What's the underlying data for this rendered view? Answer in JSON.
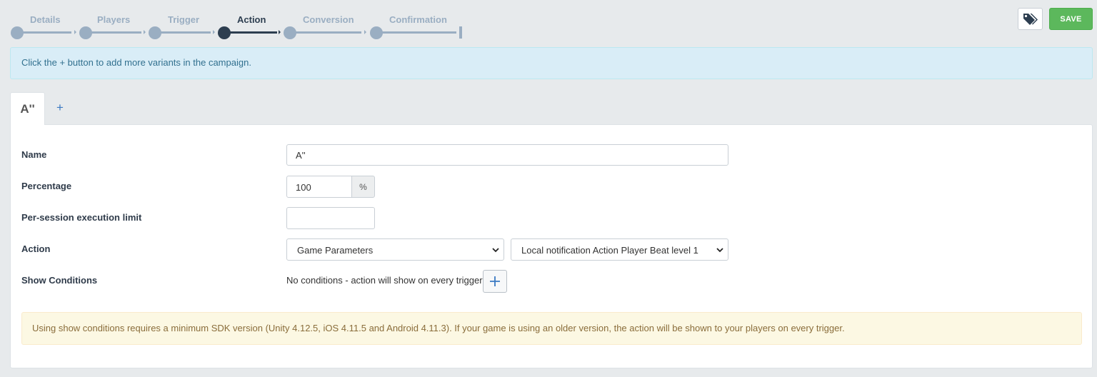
{
  "wizard": {
    "steps": [
      {
        "label": "Details",
        "state": "done"
      },
      {
        "label": "Players",
        "state": "done"
      },
      {
        "label": "Trigger",
        "state": "done"
      },
      {
        "label": "Action",
        "state": "active"
      },
      {
        "label": "Conversion",
        "state": "pending"
      },
      {
        "label": "Confirmation",
        "state": "pending"
      }
    ]
  },
  "toolbar": {
    "tag_icon": "tags-icon",
    "save_label": "SAVE"
  },
  "info_message": "Click the + button to add more variants in the campaign.",
  "tabs": {
    "items": [
      {
        "label": "A''",
        "active": true
      }
    ],
    "add_label": "+"
  },
  "form": {
    "name": {
      "label": "Name",
      "value": "A''"
    },
    "percentage": {
      "label": "Percentage",
      "value": "100",
      "suffix": "%"
    },
    "session_limit": {
      "label": "Per-session execution limit",
      "value": ""
    },
    "action": {
      "label": "Action",
      "type_selected": "Game Parameters",
      "action_selected": "Local notification Action Player Beat level 1"
    },
    "show_conditions": {
      "label": "Show Conditions",
      "empty_text": "No conditions - action will show on every trigger",
      "add_icon": "plus-icon"
    }
  },
  "warning_message": "Using show conditions requires a minimum SDK version (Unity 4.12.5, iOS 4.11.5 and Android 4.11.3). If your game is using an older version, the action will be shown to your players on every trigger.",
  "colors": {
    "accent_dark": "#2d3e50",
    "step_inactive": "#9aaec2",
    "save_green": "#5cb85c",
    "info_bg": "#d9edf7",
    "warning_bg": "#fcf8e3"
  }
}
